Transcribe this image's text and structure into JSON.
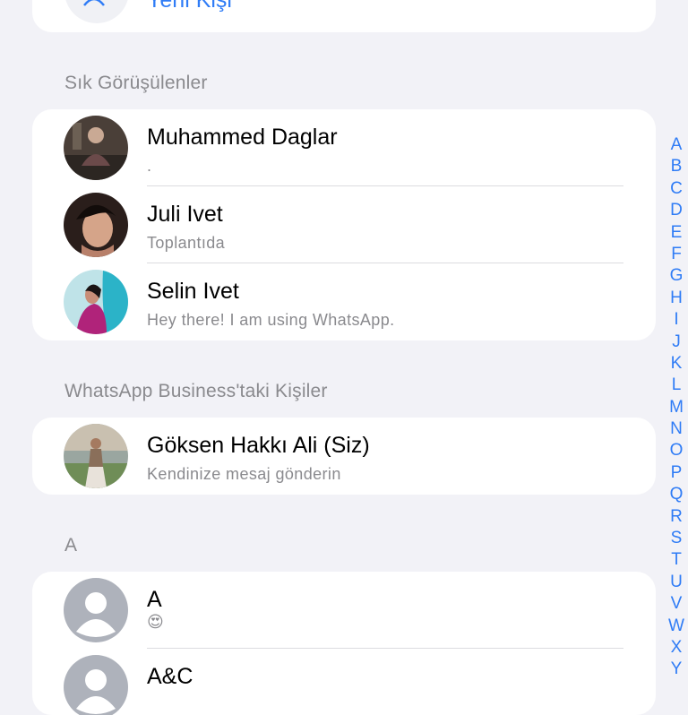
{
  "new_contact": {
    "label": "Yeni Kişi",
    "icon": "add-person-icon"
  },
  "sections": {
    "frequent": {
      "title": "Sık Görüşülenler",
      "contacts": [
        {
          "name": "Muhammed Daglar",
          "status": "."
        },
        {
          "name": "Juli Ivet",
          "status": "Toplantıda"
        },
        {
          "name": "Selin Ivet",
          "status": "Hey there! I am using WhatsApp."
        }
      ]
    },
    "business": {
      "title": "WhatsApp Business'taki Kişiler",
      "contacts": [
        {
          "name": "Göksen Hakkı Ali (Siz)",
          "status": "Kendinize mesaj gönderin"
        }
      ]
    },
    "a": {
      "title": "A",
      "contacts": [
        {
          "name": "A",
          "status": "😍"
        },
        {
          "name": "A&C",
          "status": ""
        }
      ]
    }
  },
  "index_letters": [
    "A",
    "B",
    "C",
    "D",
    "E",
    "F",
    "G",
    "H",
    "I",
    "J",
    "K",
    "L",
    "M",
    "N",
    "O",
    "P",
    "Q",
    "R",
    "S",
    "T",
    "U",
    "V",
    "W",
    "X",
    "Y"
  ],
  "colors": {
    "accent": "#2f7cf6",
    "background": "#f2f2f7",
    "secondary_text": "#8a8a8e"
  }
}
